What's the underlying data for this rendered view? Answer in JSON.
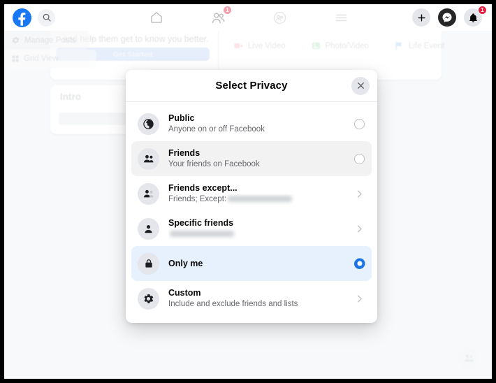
{
  "topbar": {
    "logo_icon": "facebook-logo-icon",
    "search_icon": "search-icon",
    "tabs": [
      {
        "name": "home",
        "icon": "home-icon",
        "badge": ""
      },
      {
        "name": "friends",
        "icon": "friends-icon",
        "badge": "1"
      },
      {
        "name": "groups",
        "icon": "groups-icon",
        "badge": ""
      },
      {
        "name": "menu",
        "icon": "hamburger-menu-icon",
        "badge": ""
      }
    ],
    "actions": [
      {
        "name": "create",
        "icon": "plus-icon",
        "badge": ""
      },
      {
        "name": "messenger",
        "icon": "messenger-icon",
        "badge": ""
      },
      {
        "name": "notifications",
        "icon": "bell-icon",
        "badge": "1"
      }
    ]
  },
  "background": {
    "composer_prompt": "and help them get to know you better.",
    "get_started_label": "Get Started",
    "actions": [
      {
        "label": "Live Video",
        "icon": "live-video-icon",
        "color": "#f3425f"
      },
      {
        "label": "Photo/Video",
        "icon": "photo-video-icon",
        "color": "#45bd62"
      },
      {
        "label": "Life Event",
        "icon": "life-event-icon",
        "color": "#1877f2"
      }
    ],
    "intro_title": "Intro",
    "manage_posts_label": "Manage Posts",
    "manage_posts_icon": "gear-icon",
    "grid_view_label": "Grid View",
    "grid_view_icon": "grid-icon",
    "chat_fab_icon": "contacts-icon"
  },
  "modal": {
    "title": "Select Privacy",
    "close_icon": "close-icon",
    "options": [
      {
        "title": "Public",
        "subtitle": "Anyone on or off Facebook",
        "icon": "globe-icon",
        "control": "radio",
        "selected": false,
        "state": "default",
        "redacted": false
      },
      {
        "title": "Friends",
        "subtitle": "Your friends on Facebook",
        "icon": "friends-icon",
        "control": "radio",
        "selected": false,
        "state": "hover",
        "redacted": false
      },
      {
        "title": "Friends except...",
        "subtitle": "Friends; Except:",
        "icon": "friends-except-icon",
        "control": "chevron",
        "selected": false,
        "state": "default",
        "redacted": true,
        "redacted_width": 92
      },
      {
        "title": "Specific friends",
        "subtitle": "",
        "icon": "person-icon",
        "control": "chevron",
        "selected": false,
        "state": "default",
        "redacted": true,
        "redacted_width": 92,
        "subtitle_fully_redacted": true
      },
      {
        "title": "Only me",
        "subtitle": "",
        "icon": "lock-icon",
        "control": "radio",
        "selected": true,
        "state": "selected",
        "redacted": false
      },
      {
        "title": "Custom",
        "subtitle": "Include and exclude friends and lists",
        "icon": "gear-icon",
        "control": "chevron",
        "selected": false,
        "state": "default",
        "redacted": false
      }
    ]
  },
  "colors": {
    "brand_blue": "#1877f2",
    "selected_blue": "#1b74e4",
    "selected_row_bg": "#e7f0fd",
    "hover_row_bg": "#f2f2f2",
    "page_bg": "#f0f2f5",
    "badge_red": "#e41e3f"
  }
}
